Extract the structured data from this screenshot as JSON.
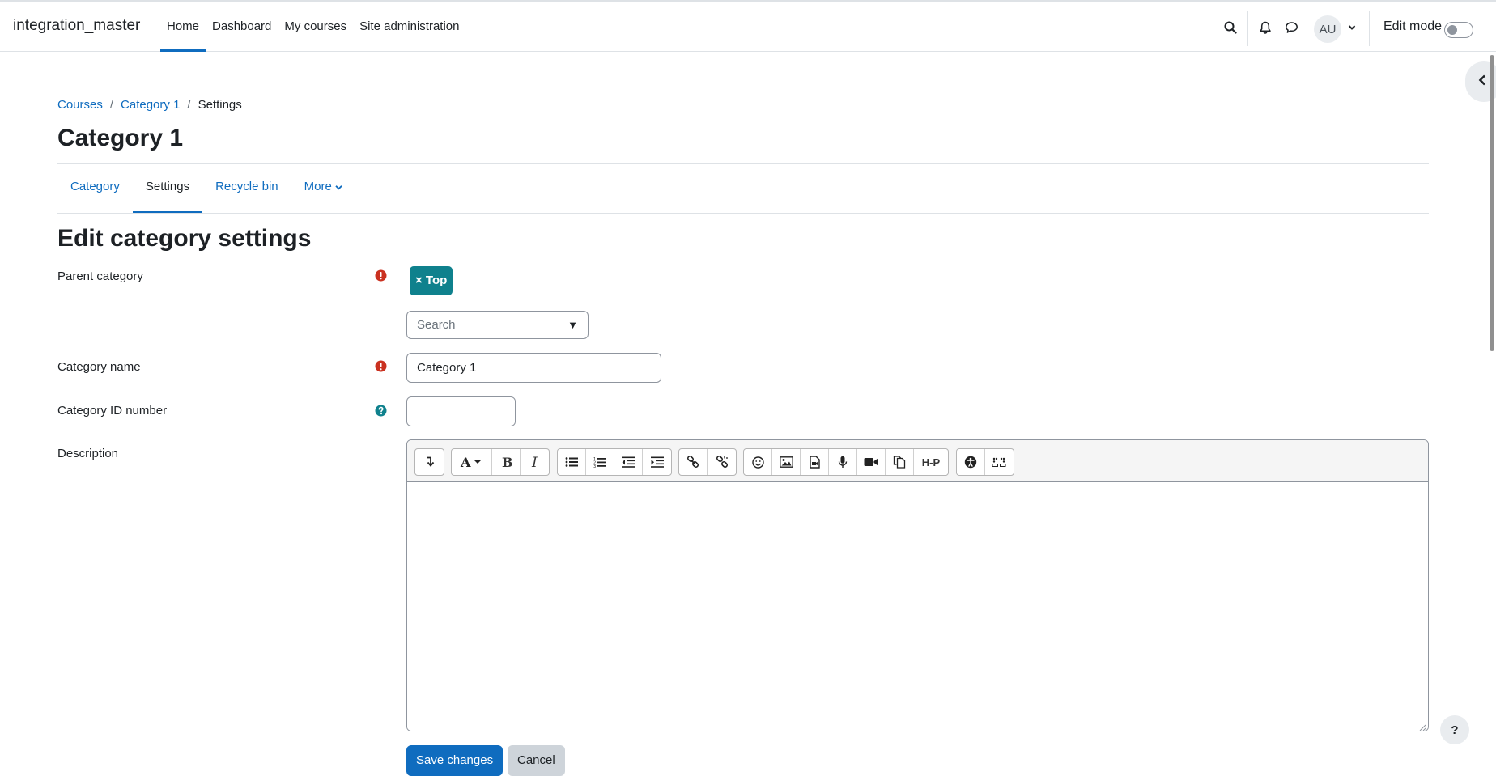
{
  "navbar": {
    "site_name": "integration_master",
    "links": [
      {
        "label": "Home",
        "active": true
      },
      {
        "label": "Dashboard",
        "active": false
      },
      {
        "label": "My courses",
        "active": false
      },
      {
        "label": "Site administration",
        "active": false
      }
    ],
    "icons": [
      "search-icon",
      "bell-icon",
      "chat-icon"
    ],
    "user_initials": "AU",
    "edit_mode_label": "Edit mode",
    "edit_mode_on": false
  },
  "breadcrumb": {
    "items": [
      "Courses",
      "Category 1"
    ],
    "current": "Settings",
    "separator": "/"
  },
  "page_title": "Category 1",
  "secondary_nav": {
    "tabs": [
      {
        "label": "Category",
        "active": false
      },
      {
        "label": "Settings",
        "active": true
      },
      {
        "label": "Recycle bin",
        "active": false
      },
      {
        "label": "More",
        "active": false
      }
    ]
  },
  "section_title": "Edit category settings",
  "form": {
    "parent_category": {
      "label": "Parent category",
      "selected_chip": "× Top",
      "search_placeholder": "Search",
      "arrow": "▼"
    },
    "category_name": {
      "label": "Category name",
      "value": "Category 1"
    },
    "category_id": {
      "label": "Category ID number",
      "value": ""
    },
    "description": {
      "label": "Description",
      "value": ""
    },
    "toolbar_buttons": [
      "show-more-icon",
      "font-style-icon",
      "bold-icon",
      "italic-icon",
      "unordered-list-icon",
      "ordered-list-icon",
      "outdent-icon",
      "indent-icon",
      "link-icon",
      "unlink-icon",
      "emoji-icon",
      "image-icon",
      "media-file-icon",
      "record-audio-icon",
      "record-video-icon",
      "manage-files-icon",
      "h5p-icon",
      "accessibility-checker-icon",
      "screenreader-helper-icon"
    ],
    "h5p_label": "H-P"
  },
  "buttons": {
    "save": "Save changes",
    "cancel": "Cancel"
  },
  "help_button": "?",
  "colors": {
    "primary": "#0f6cbf",
    "chip": "#0f818d",
    "required": "#ca3120",
    "help": "#0f818d"
  }
}
